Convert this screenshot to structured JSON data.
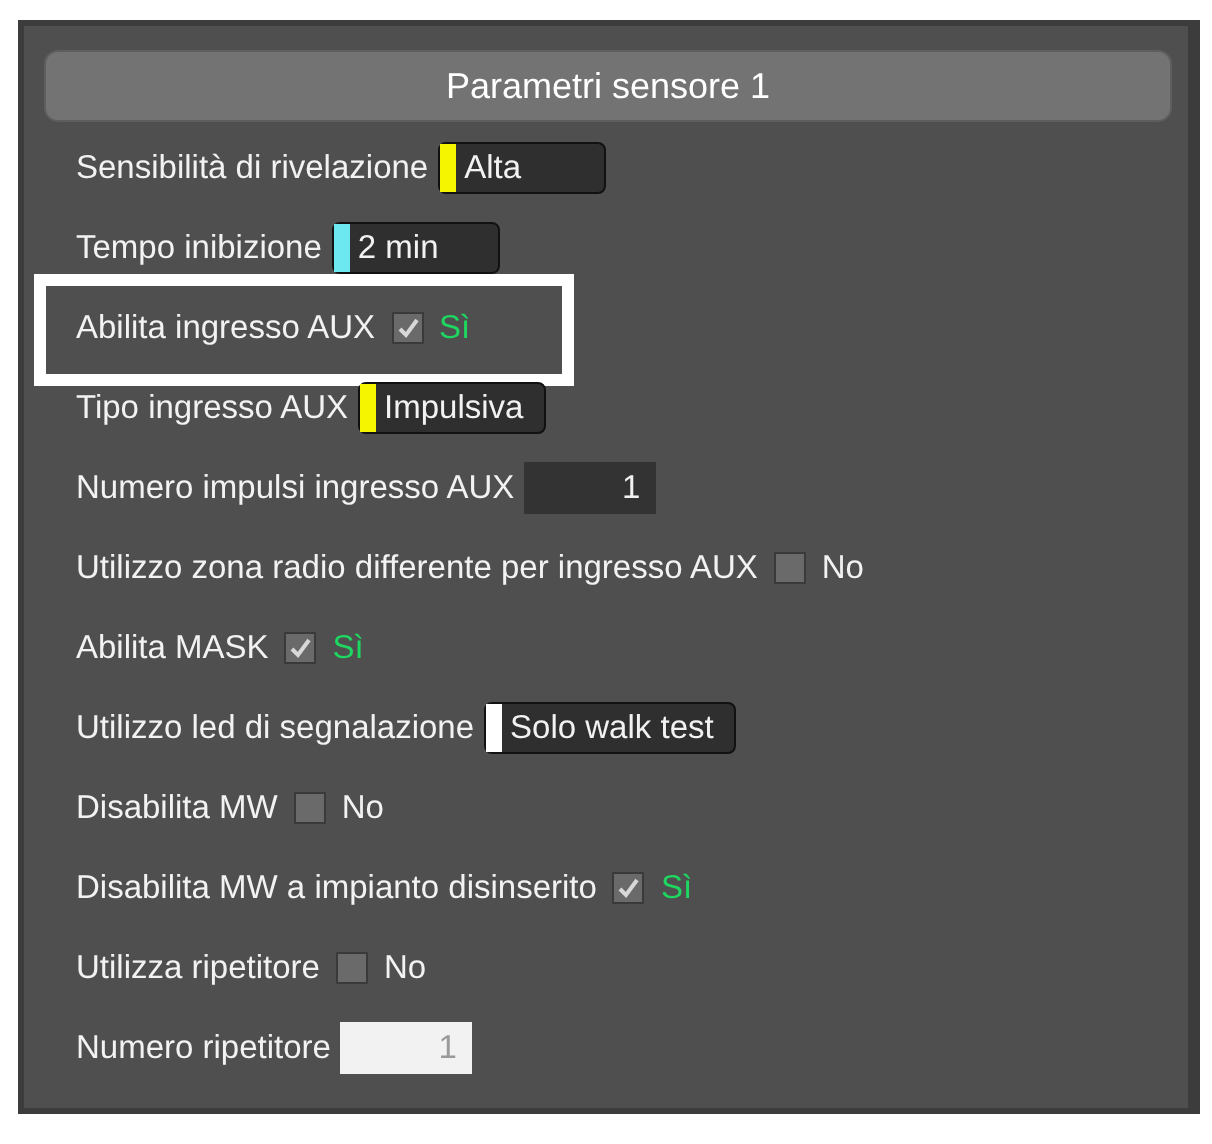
{
  "panel": {
    "title": "Parametri sensore 1"
  },
  "rows": [
    {
      "kind": "select",
      "label": "Sensibilità di rivelazione",
      "value": "Alta",
      "color": "#f5f500"
    },
    {
      "kind": "select",
      "label": "Tempo inibizione",
      "value": "2 min",
      "color": "#6ee8f0"
    },
    {
      "kind": "checkbox",
      "label": "Abilita ingresso AUX",
      "checked": true,
      "value": "Sì",
      "highlighted": true
    },
    {
      "kind": "select",
      "label": "Tipo ingresso AUX",
      "value": "Impulsiva",
      "color": "#f5f500"
    },
    {
      "kind": "number",
      "label": "Numero impulsi ingresso AUX",
      "value": "1",
      "disabled": false
    },
    {
      "kind": "checkbox",
      "label": "Utilizzo zona radio differente per ingresso AUX",
      "checked": false,
      "value": "No"
    },
    {
      "kind": "checkbox",
      "label": "Abilita MASK",
      "checked": true,
      "value": "Sì"
    },
    {
      "kind": "select",
      "label": "Utilizzo led di segnalazione",
      "value": "Solo walk test",
      "color": "#ffffff"
    },
    {
      "kind": "checkbox",
      "label": "Disabilita MW",
      "checked": false,
      "value": "No"
    },
    {
      "kind": "checkbox",
      "label": "Disabilita MW a impianto disinserito",
      "checked": true,
      "value": "Sì"
    },
    {
      "kind": "checkbox",
      "label": "Utilizza ripetitore",
      "checked": false,
      "value": "No"
    },
    {
      "kind": "number",
      "label": "Numero ripetitore",
      "value": "1",
      "disabled": true
    }
  ]
}
